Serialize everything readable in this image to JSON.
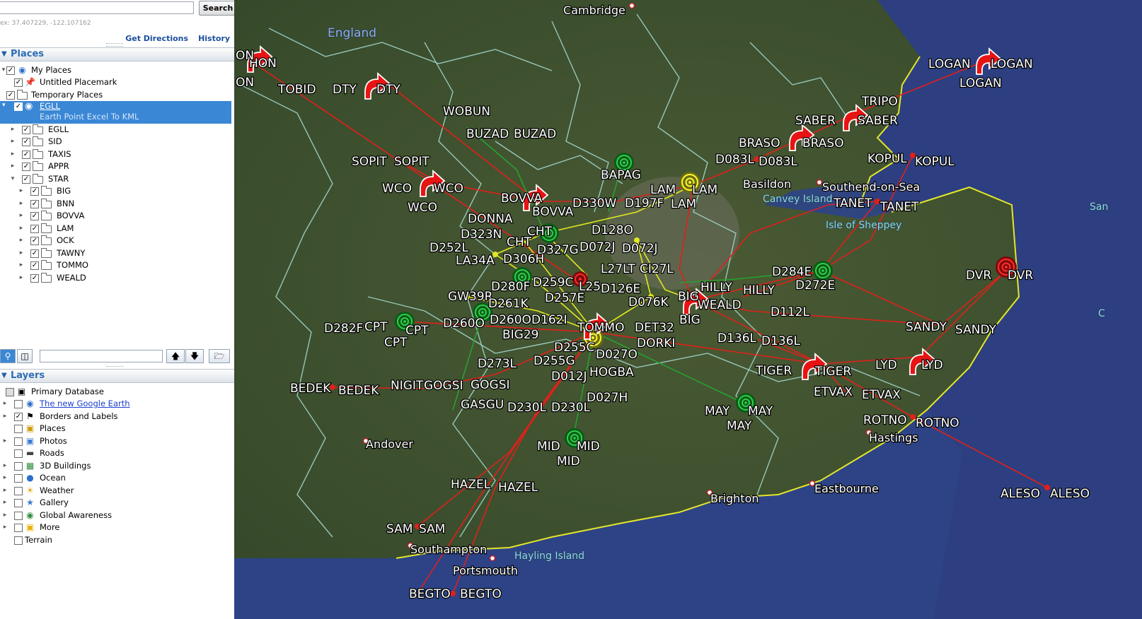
{
  "search": {
    "value": "",
    "button_label": "Search"
  },
  "coord_hint": "ex: 37.407229, -122.107162",
  "links": {
    "directions": "Get Directions",
    "history": "History"
  },
  "places": {
    "title": "Places",
    "my_places": "My Places",
    "untitled": "Untitled Placemark",
    "temporary": "Temporary Places",
    "selected_title": "EGLL",
    "selected_desc": "Earth Point Excel To KML",
    "folders": [
      "EGLL",
      "SID",
      "TAXIS",
      "APPR",
      "STAR"
    ],
    "star_folders": [
      "BIG",
      "BNN",
      "BOVVA",
      "LAM",
      "OCK",
      "TAWNY",
      "TOMMO",
      "WEALD"
    ]
  },
  "layers": {
    "title": "Layers",
    "items": [
      {
        "label": "Primary Database",
        "checked": false,
        "link": false
      },
      {
        "label": "The new Google Earth",
        "checked": false,
        "link": true
      },
      {
        "label": "Borders and Labels",
        "checked": true,
        "link": false
      },
      {
        "label": "Places",
        "checked": false,
        "link": false
      },
      {
        "label": "Photos",
        "checked": false,
        "link": false
      },
      {
        "label": "Roads",
        "checked": false,
        "link": false
      },
      {
        "label": "3D Buildings",
        "checked": false,
        "link": false
      },
      {
        "label": "Ocean",
        "checked": false,
        "link": false
      },
      {
        "label": "Weather",
        "checked": false,
        "link": false
      },
      {
        "label": "Gallery",
        "checked": false,
        "link": false
      },
      {
        "label": "Global Awareness",
        "checked": false,
        "link": false
      },
      {
        "label": "More",
        "checked": false,
        "link": false
      },
      {
        "label": "Terrain",
        "checked": false,
        "link": false
      }
    ]
  },
  "map": {
    "places": {
      "england": "England",
      "cambridge": "Cambridge",
      "basildon": "Basildon",
      "canvey": "Canvey Island",
      "southend": "Southend-on-Sea",
      "sheppey": "Isle of Sheppey",
      "andover": "Andover",
      "brighton": "Brighton",
      "eastbourne": "Eastbourne",
      "hastings": "Hastings",
      "southampton": "Southampton",
      "portsmouth": "Portsmouth",
      "hayling": "Hayling Island",
      "edge_san": "San",
      "edge_c": "C"
    },
    "fixes": {
      "hon": "HON",
      "on": "ON",
      "tobid": "TOBID",
      "dty": "DTY",
      "wobun": "WOBUN",
      "buzad": "BUZAD",
      "sopit": "SOPIT",
      "wco": "WCO",
      "bovva": "BOVVA",
      "donna": "DONNA",
      "d323n": "D323N",
      "d252l": "D252L",
      "la34a": "LA34A",
      "cht": "CHT",
      "d327g": "D327G",
      "d306h": "D306H",
      "d330w": "D330W",
      "d197f": "D197F",
      "lam": "LAM",
      "bapag": "BAPAG",
      "d128o": "D128O",
      "d072j": "D072J",
      "l27lt": "L27LT",
      "ci27l": "CI27L",
      "d280f": "D280F",
      "d259c": "D259C",
      "l25": "L25",
      "d126e": "D126E",
      "gw39r": "GW39R",
      "d261k": "D261K",
      "d257e": "D257E",
      "d076k": "D076K",
      "big": "BIG",
      "hilly": "HILLY",
      "weald": "WEALD",
      "d260o": "D260O",
      "d162i": "D162I",
      "tommo": "TOMMO",
      "det32": "DET32",
      "dorki": "DORKI",
      "d282f": "D282F",
      "cpt": "CPT",
      "big29": "BIG29",
      "d255c": "D255C",
      "d027o": "D027O",
      "d273l": "D273L",
      "d255g": "D255G",
      "d012j": "D012J",
      "hogba": "HOGBA",
      "bedek": "BEDEK",
      "nigit": "NIGIT",
      "gogsi": "GOGSI",
      "gasgu": "GASGU",
      "d230l": "D230L",
      "d027h": "D027H",
      "mid": "MID",
      "may": "MAY",
      "hazel": "HAZEL",
      "sam": "SAM",
      "begto": "BEGTO",
      "logan": "LOGAN",
      "tripo": "TRIPO",
      "saber": "SABER",
      "braso": "BRASO",
      "d083l": "D083L",
      "kopul": "KOPUL",
      "tanet": "TANET",
      "d284e": "D284E",
      "d272e": "D272E",
      "d112l": "D112L",
      "dvr": "DVR",
      "sandy": "SANDY",
      "d136l": "D136L",
      "tiger": "TIGER",
      "lyd": "LYD",
      "etvax": "ETVAX",
      "rotno": "ROTNO",
      "aleso": "ALESO"
    }
  }
}
